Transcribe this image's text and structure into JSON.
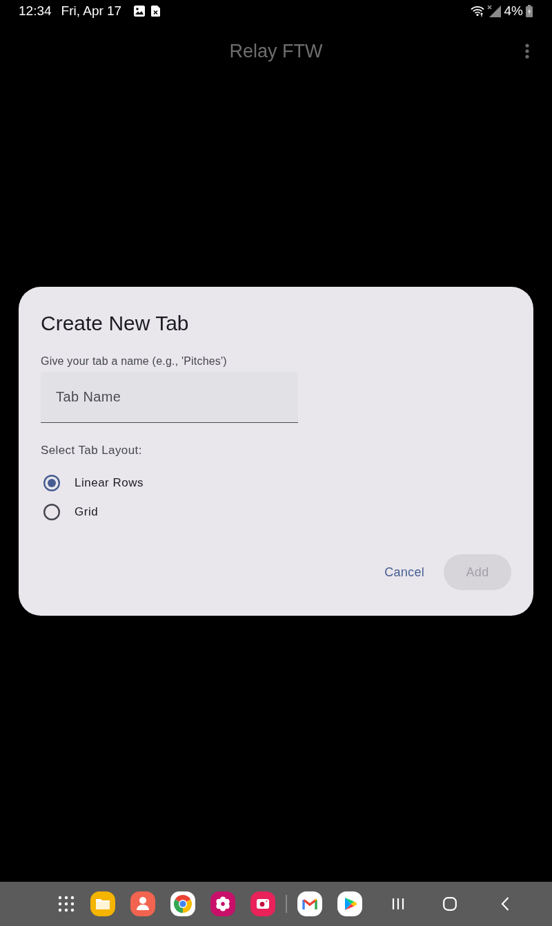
{
  "status_bar": {
    "time": "12:34",
    "date": "Fri, Apr 17",
    "battery": "4%"
  },
  "app_bar": {
    "title": "Relay FTW"
  },
  "dialog": {
    "title": "Create New Tab",
    "prompt": "Give your tab a name (e.g., 'Pitches')",
    "name_field": {
      "placeholder": "Tab Name"
    },
    "layout_label": "Select Tab Layout:",
    "layout_options": [
      {
        "label": "Linear Rows",
        "selected": true
      },
      {
        "label": "Grid",
        "selected": false
      }
    ],
    "buttons": [
      {
        "label": "Cancel",
        "kind": "text",
        "disabled": false
      },
      {
        "label": "Add",
        "kind": "filled",
        "disabled": true
      }
    ]
  }
}
